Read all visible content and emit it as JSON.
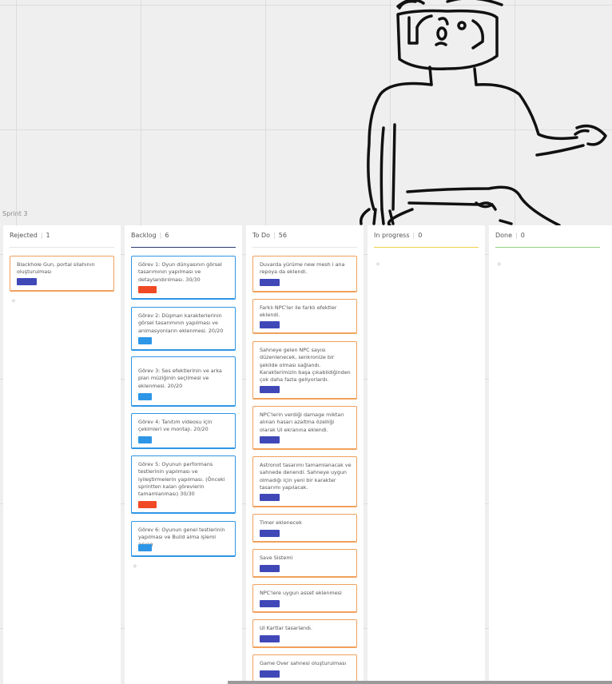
{
  "board": {
    "sprint_label": "Sprint 3"
  },
  "colors": {
    "orange_tag": "#f04a24",
    "blue_tag": "#2e96e6",
    "indigo_tag": "#4048b8"
  },
  "columns": [
    {
      "name": "Rejected",
      "count": "1",
      "line_color": "#e5e5e5",
      "cards": [
        {
          "text": "Blackhole Gun, portal silahının oluşturulması",
          "tag_color": "indigo"
        }
      ]
    },
    {
      "name": "Backlog",
      "count": "6",
      "line_color": "#2d3a6e",
      "cards": [
        {
          "text": "Görev 1: Oyun dünyasının görsel tasarımının yapılması ve detaylandırılması. 30/30",
          "tag_color": "red"
        },
        {
          "text": "Görev 2: Düşman karakterlerinin görsel tasarımının yapılması ve animasyonların eklenmesi. 20/20",
          "tag_color": "blue"
        },
        {
          "text": "Görev 3: Ses efektlerinin ve arka plan müziğinin seçilmesi ve eklenmesi. 20/20",
          "tag_color": "blue"
        },
        {
          "text": "Görev 4: Tanıtım videosu için çekimleri ve montajı. 20/20",
          "tag_color": "blue"
        },
        {
          "text": "Görev 5: Oyunun performans testlerinin yapılması ve iyileştirmelerin yapılması. (Önceki sprintten kalan görevlerin tamamlanması) 30/30",
          "tag_color": "red"
        },
        {
          "text": "Görev 6: Oyunun genel testlerinin yapılması ve Build alma işlemi 20/20",
          "tag_color": "blue"
        }
      ]
    },
    {
      "name": "To Do",
      "count": "56",
      "line_color": "#e5e5e5",
      "cards": [
        {
          "text": "Duvarda yürüme new mesh i ana repoya da eklendi.",
          "tag_color": "indigo"
        },
        {
          "text": "Farklı NPC'ler ile farklı efektler eklendi.",
          "tag_color": "indigo"
        },
        {
          "text": "Sahneye gelen NPC sayısı düzenlenecek, senkronize bir şekilde olması sağlandı. Karakterimizin başa çıkabildiğinden çok daha fazla geliyorlardı.",
          "tag_color": "indigo"
        },
        {
          "text": "NPC'lerin verdiği damage miktarı alınan hasarı azaltma özelliği olarak UI ekranına eklendi.",
          "tag_color": "indigo"
        },
        {
          "text": "Astronot tasarımı tamamlanacak ve sahnede denendi. Sahneye uygun olmadığı için yeni bir karakter tasarımı yapılacak.",
          "tag_color": "indigo"
        },
        {
          "text": "Timer eklenecek",
          "tag_color": "indigo"
        },
        {
          "text": "Save Sistemi",
          "tag_color": "indigo"
        },
        {
          "text": "NPC'lere uygun asset eklenmesi",
          "tag_color": "indigo"
        },
        {
          "text": "UI Kartlar tasarlandı.",
          "tag_color": "indigo"
        },
        {
          "text": "Game Over sahnesi oluşturulması",
          "tag_color": "indigo"
        }
      ]
    },
    {
      "name": "In progress",
      "count": "0",
      "line_color": "#f2d24a",
      "cards": []
    },
    {
      "name": "Done",
      "count": "0",
      "line_color": "#8fd37a",
      "cards": []
    }
  ]
}
